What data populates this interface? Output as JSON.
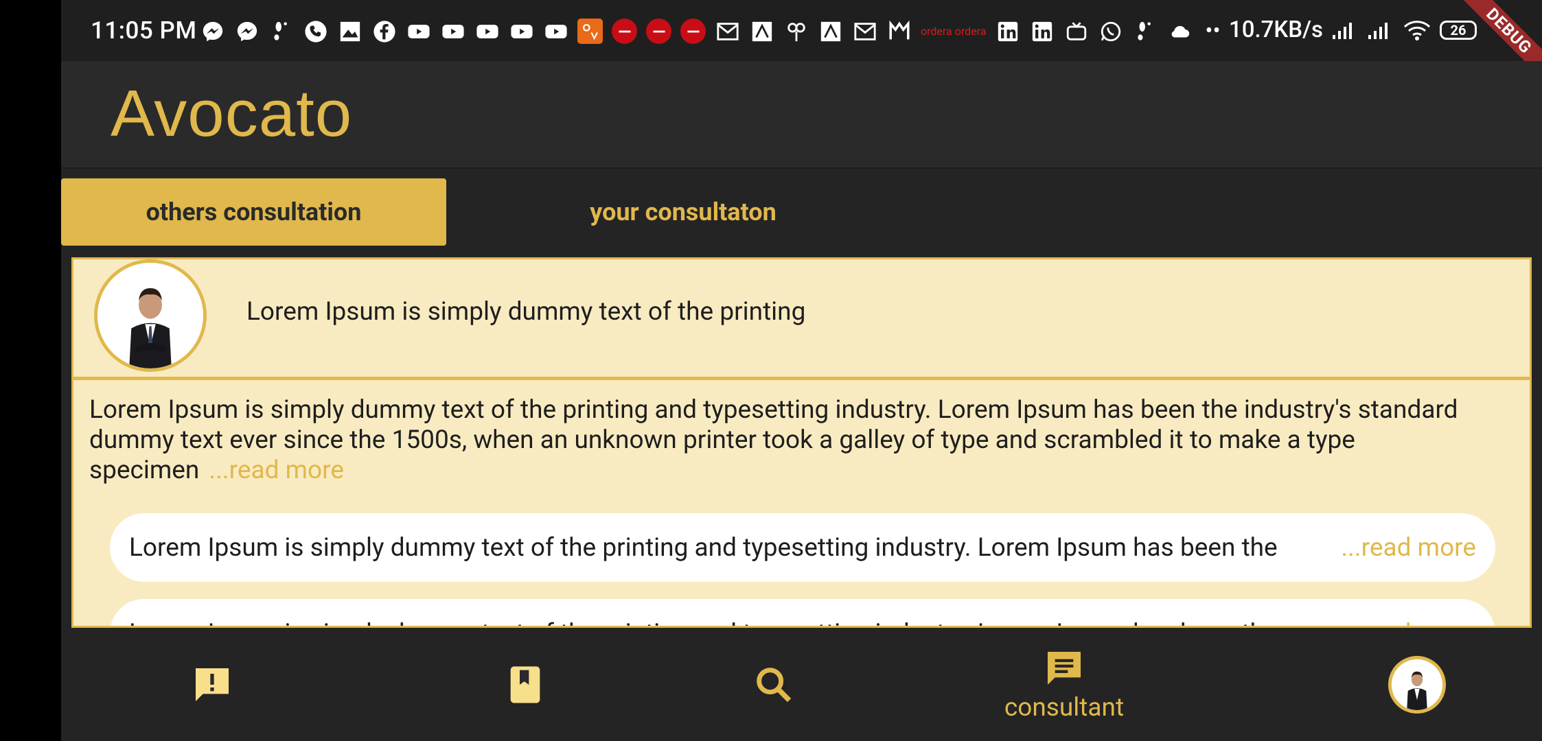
{
  "status_bar": {
    "time": "11:05 PM",
    "net_speed": "10.7KB/s",
    "battery": "26",
    "debug_label": "DEBUG",
    "icons": [
      "messenger-icon",
      "messenger-icon",
      "footprint-icon",
      "phone-icon",
      "image-icon",
      "facebook-icon",
      "youtube-icon",
      "youtube-icon",
      "youtube-icon",
      "youtube-icon",
      "youtube-icon",
      "app-orange-icon",
      "red-app-icon",
      "red-app-icon",
      "red-app-icon",
      "gmail-icon",
      "app-icon",
      "app-icon",
      "app-icon",
      "gmail-icon",
      "app-icon"
    ],
    "icon_text_red": "ordera ordera"
  },
  "app_bar": {
    "title": "Avocato"
  },
  "tabs": [
    {
      "label": "others consultation",
      "active": true
    },
    {
      "label": "your consultaton",
      "active": false
    }
  ],
  "post": {
    "title": "Lorem Ipsum is simply dummy text of the printing",
    "body": "Lorem Ipsum is simply dummy text of the printing and typesetting industry. Lorem Ipsum has been the industry's standard dummy text ever since the 1500s, when an unknown printer took a galley of type and scrambled it to make a type specimen",
    "read_more": "...read more"
  },
  "comments": [
    {
      "text": "Lorem Ipsum is simply dummy text of the printing and typesetting industry. Lorem Ipsum has been the",
      "read_more": "...read more"
    },
    {
      "text": "Lorem Ipsum is simply dummy text of the printing and typesetting industry. Lorem Ipsum has been the",
      "read_more": "...read more"
    }
  ],
  "bottom_nav": {
    "items": [
      {
        "name": "reports",
        "icon": "feedback-icon"
      },
      {
        "name": "book",
        "icon": "bookmark-icon"
      },
      {
        "name": "search",
        "icon": "search-icon"
      },
      {
        "name": "consultant",
        "icon": "chat-icon",
        "label": "consultant",
        "active": true
      },
      {
        "name": "profile",
        "icon": "avatar"
      }
    ]
  },
  "colors": {
    "accent": "#e0b84c",
    "background": "#242424",
    "card": "#f9ebc1"
  }
}
